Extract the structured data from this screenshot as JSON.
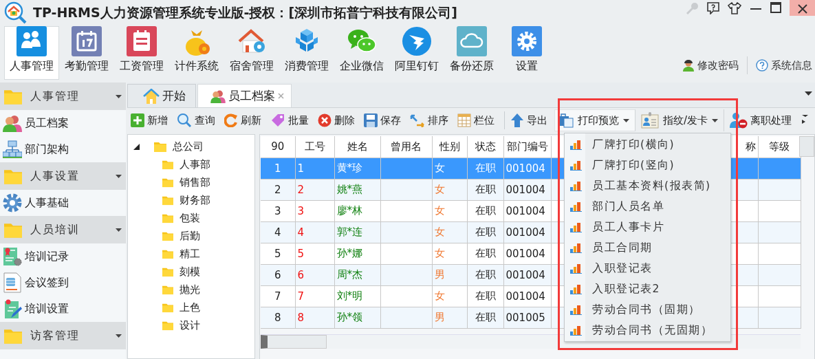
{
  "window": {
    "title": "TP-HRMS人力资源管理系统专业版-授权：[深圳市拓普宁科技有限公司]"
  },
  "modules": [
    {
      "label": "人事管理",
      "selected": true
    },
    {
      "label": "考勤管理",
      "selected": false
    },
    {
      "label": "工资管理",
      "selected": false
    },
    {
      "label": "计件系统",
      "selected": false
    },
    {
      "label": "宿舍管理",
      "selected": false
    },
    {
      "label": "消费管理",
      "selected": false
    },
    {
      "label": "企业微信",
      "selected": false
    },
    {
      "label": "阿里钉钉",
      "selected": false
    },
    {
      "label": "备份还原",
      "selected": false
    },
    {
      "label": "设置",
      "selected": false
    }
  ],
  "account_links": [
    "修改密码",
    "系统信息"
  ],
  "sidebar": {
    "groups": [
      {
        "label": "人事管理",
        "items": [
          "员工档案",
          "部门架构"
        ]
      },
      {
        "label": "人事设置",
        "items": [
          "人事基础"
        ]
      },
      {
        "label": "人员培训",
        "items": [
          "培训记录",
          "会议签到",
          "培训设置"
        ]
      },
      {
        "label": "访客管理"
      }
    ]
  },
  "tabs": [
    {
      "label": "开始",
      "selected": false,
      "closable": false
    },
    {
      "label": "员工档案",
      "selected": true,
      "closable": true
    }
  ],
  "toolbar": [
    {
      "kind": "button",
      "label": "新增"
    },
    {
      "kind": "button",
      "label": "查询"
    },
    {
      "kind": "button",
      "label": "刷新"
    },
    {
      "kind": "button",
      "label": "批量"
    },
    {
      "kind": "button",
      "label": "删除"
    },
    {
      "kind": "button",
      "label": "保存"
    },
    {
      "kind": "button",
      "label": "排序"
    },
    {
      "kind": "button",
      "label": "栏位"
    },
    {
      "kind": "button",
      "label": "导出"
    },
    {
      "kind": "dropdown",
      "label": "打印预览",
      "open": true
    },
    {
      "kind": "dropdown",
      "label": "指纹/发卡",
      "open": false
    },
    {
      "kind": "button",
      "label": "离职处理"
    }
  ],
  "tree": {
    "label": "总公司",
    "expanded": true,
    "children": [
      {
        "label": "人事部"
      },
      {
        "label": "销售部"
      },
      {
        "label": "财务部"
      },
      {
        "label": "包装"
      },
      {
        "label": "后勤"
      },
      {
        "label": "精工"
      },
      {
        "label": "刻模"
      },
      {
        "label": "抛光"
      },
      {
        "label": "上色"
      },
      {
        "label": "设计"
      }
    ]
  },
  "table": {
    "columns": [
      "90",
      "工号",
      "姓名",
      "曾用名",
      "性别",
      "状态",
      "部门编号",
      "称",
      "等级"
    ],
    "rows": [
      {
        "no": "1",
        "id": "1",
        "name": "黄*珍",
        "gender": "女",
        "status": "在职",
        "dept_code": "001004",
        "selected": true
      },
      {
        "no": "2",
        "id": "2",
        "name": "姚*燕",
        "gender": "女",
        "status": "在职",
        "dept_code": "001004",
        "selected": false
      },
      {
        "no": "3",
        "id": "3",
        "name": "廖*林",
        "gender": "女",
        "status": "在职",
        "dept_code": "001004",
        "selected": false
      },
      {
        "no": "4",
        "id": "4",
        "name": "郭*连",
        "gender": "女",
        "status": "在职",
        "dept_code": "001004",
        "selected": false
      },
      {
        "no": "5",
        "id": "5",
        "name": "孙*娜",
        "gender": "女",
        "status": "在职",
        "dept_code": "001004",
        "selected": false
      },
      {
        "no": "6",
        "id": "6",
        "name": "周*杰",
        "gender": "男",
        "status": "在职",
        "dept_code": "001004",
        "selected": false
      },
      {
        "no": "7",
        "id": "7",
        "name": "刘*明",
        "gender": "女",
        "status": "在职",
        "dept_code": "001004",
        "selected": false
      },
      {
        "no": "8",
        "id": "8",
        "name": "孙*领",
        "gender": "男",
        "status": "在职",
        "dept_code": "001005",
        "selected": false
      }
    ]
  },
  "print_menu": {
    "items": [
      "厂牌打印(横向)",
      "厂牌打印(竖向)",
      "员工基本资料(报表简)",
      "部门人员名单",
      "员工人事卡片",
      "员工合同期",
      "入职登记表",
      "入职登记表2",
      "劳动合同书（固期）",
      "劳动合同书（无固期）"
    ]
  }
}
